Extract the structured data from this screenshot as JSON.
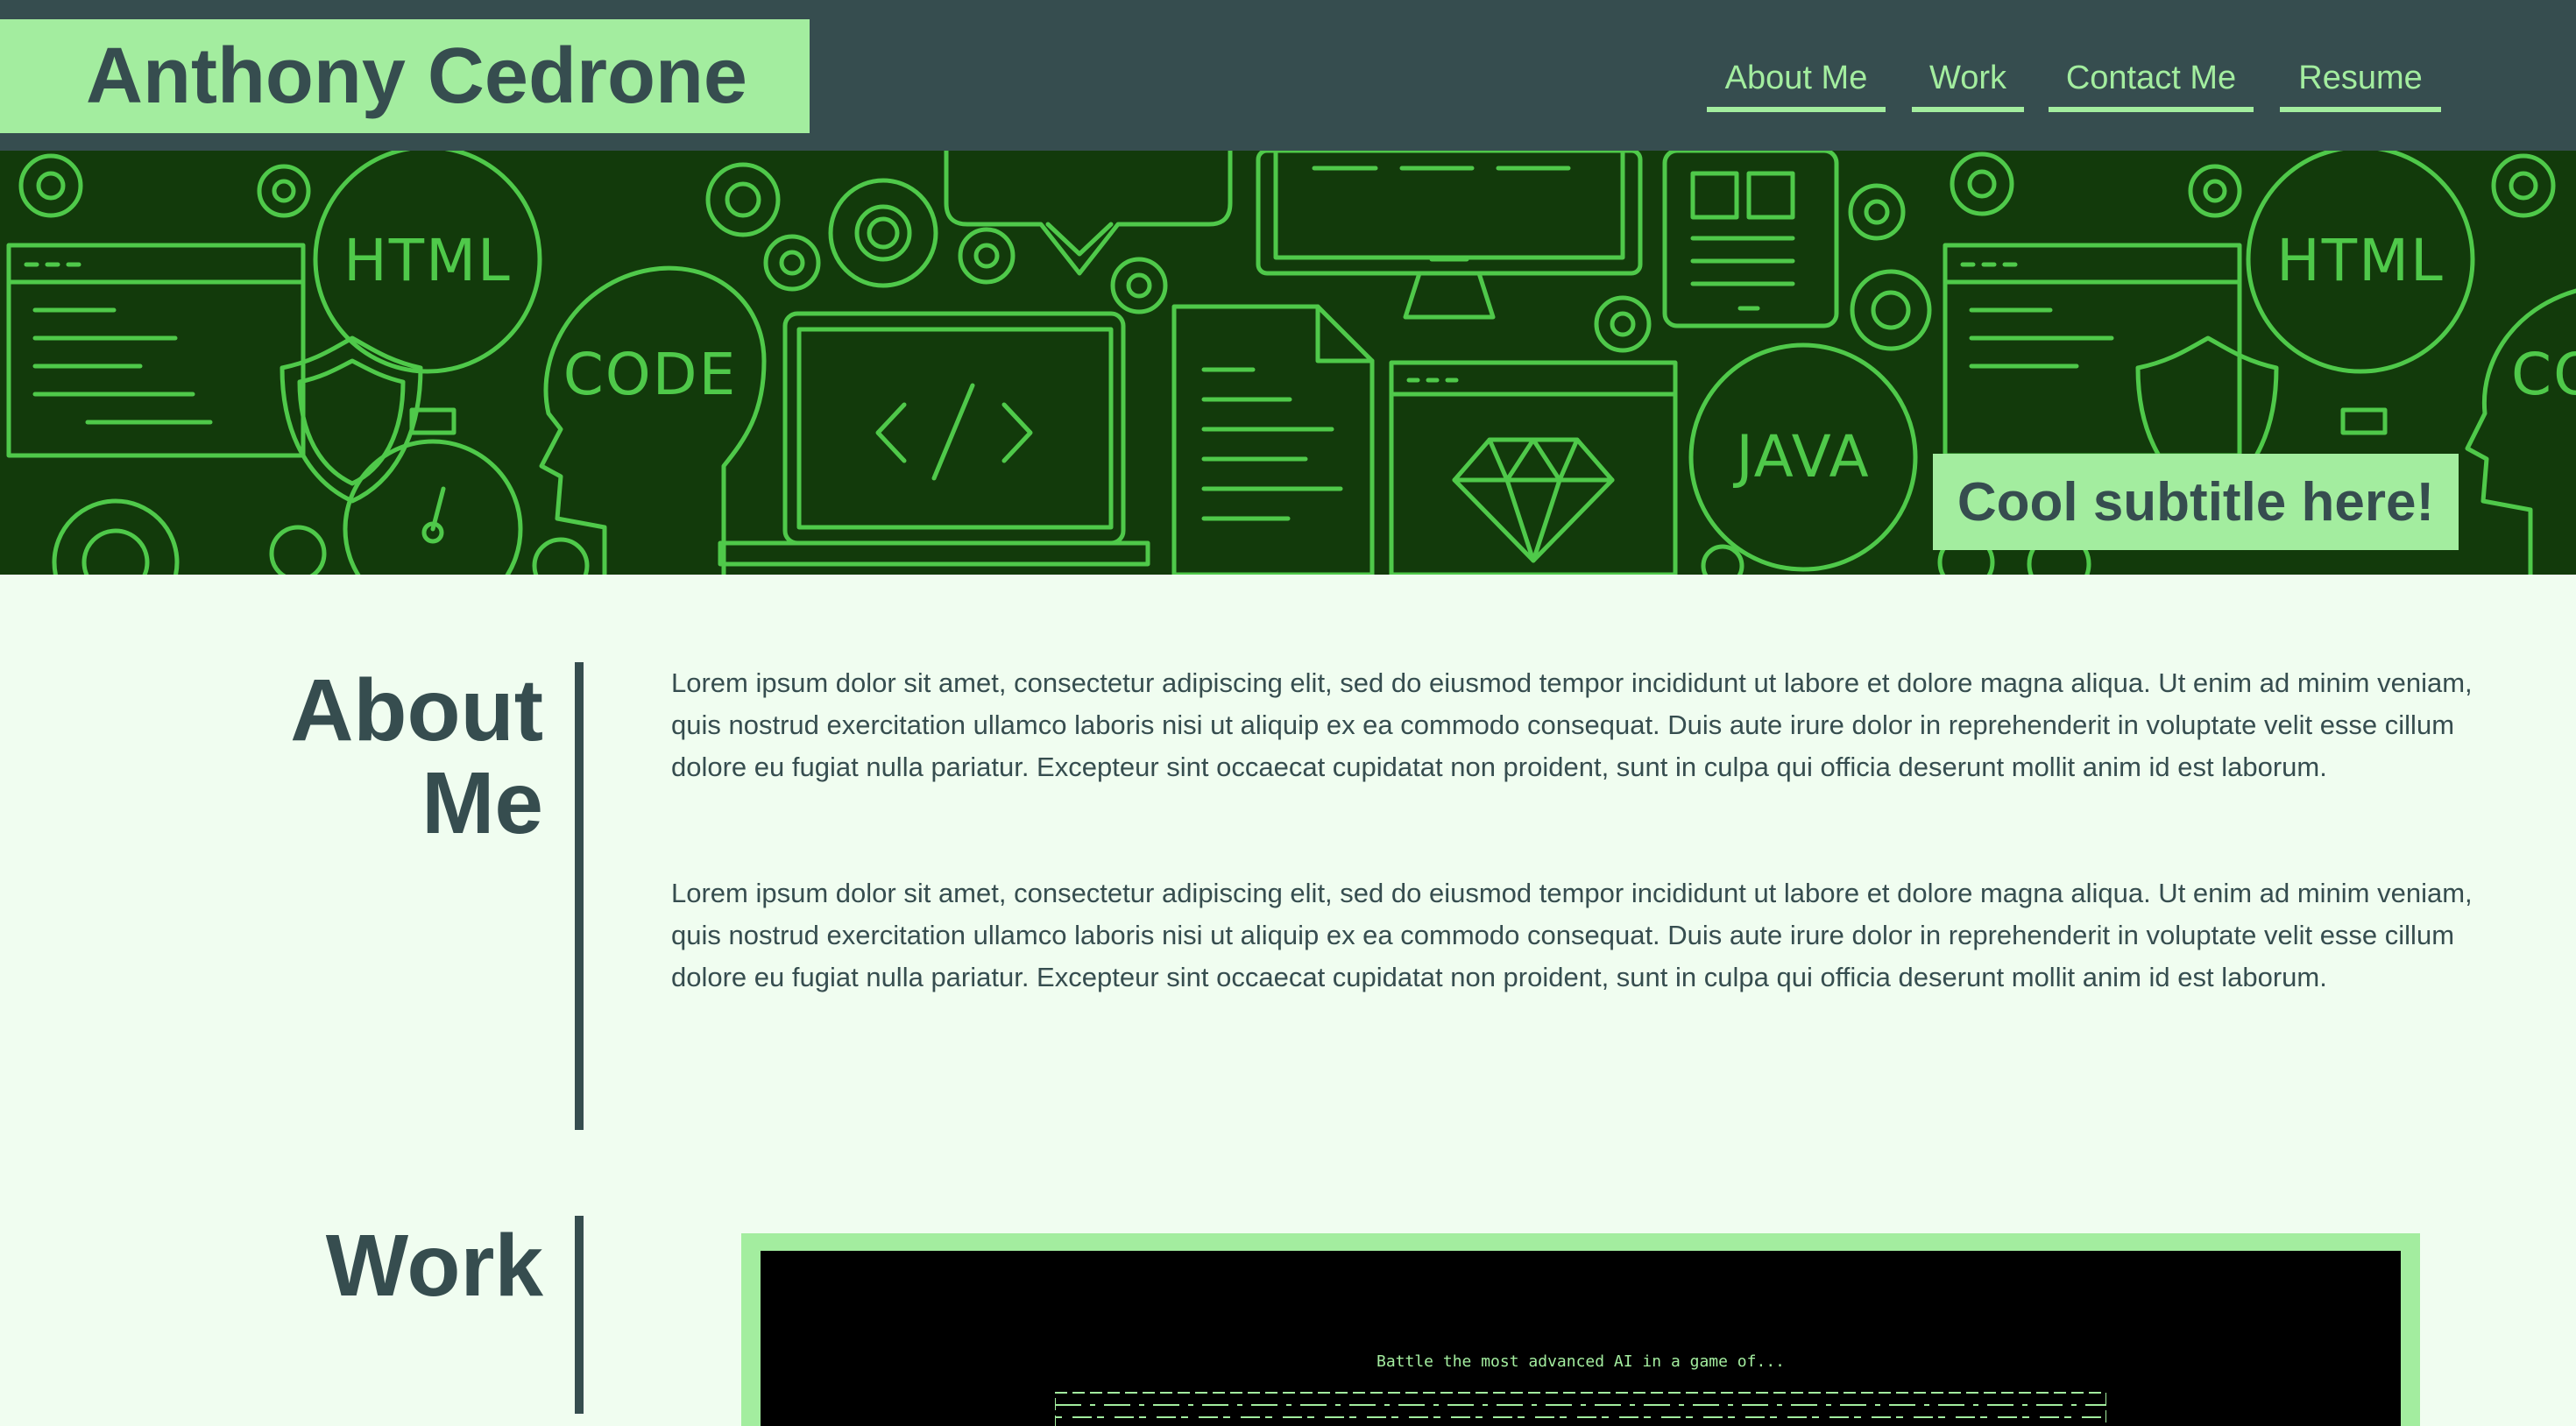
{
  "header": {
    "name": "Anthony Cedrone",
    "nav": [
      "About Me",
      "Work",
      "Contact Me",
      "Resume"
    ]
  },
  "banner": {
    "subtitle": "Cool subtitle here!",
    "icon_words": [
      "HTML",
      "CODE",
      "JAVA",
      "HTML",
      "CO"
    ]
  },
  "about": {
    "title_line1": "About",
    "title_line2": "Me",
    "paragraphs": [
      "Lorem ipsum dolor sit amet, consectetur adipiscing elit, sed do eiusmod tempor incididunt ut labore et dolore magna aliqua. Ut enim ad minim veniam, quis nostrud exercitation ullamco laboris nisi ut aliquip ex ea commodo consequat. Duis aute irure dolor in reprehenderit in voluptate velit esse cillum dolore eu fugiat nulla pariatur. Excepteur sint occaecat cupidatat non proident, sunt in culpa qui officia deserunt mollit anim id est laborum.",
      "Lorem ipsum dolor sit amet, consectetur adipiscing elit, sed do eiusmod tempor incididunt ut labore et dolore magna aliqua. Ut enim ad minim veniam, quis nostrud exercitation ullamco laboris nisi ut aliquip ex ea commodo consequat. Duis aute irure dolor in reprehenderit in voluptate velit esse cillum dolore eu fugiat nulla pariatur. Excepteur sint occaecat cupidatat non proident, sunt in culpa qui officia deserunt mollit anim id est laborum."
    ]
  },
  "work": {
    "title": "Work",
    "project_tagline": "Battle the most advanced AI in a game of..."
  },
  "colors": {
    "header_bg": "#364d4f",
    "accent": "#a3ed9f",
    "page_bg": "#f0fdf0",
    "banner_bg": "#123a0b",
    "banner_line": "#4fc94a"
  },
  "icons": [
    "gear-icon",
    "shield-icon",
    "stopwatch-icon",
    "laptop-code-icon",
    "document-icon",
    "monitor-icon",
    "browser-window-icon",
    "diamond-icon",
    "tablet-icon",
    "download-arrow-icon",
    "head-icon"
  ]
}
